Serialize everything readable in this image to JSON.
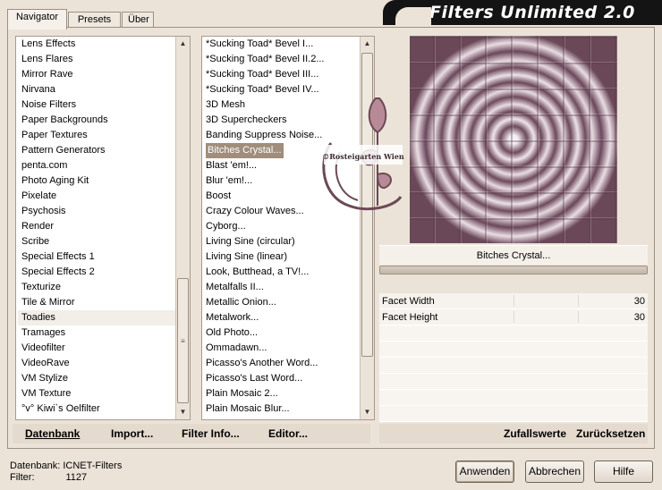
{
  "tabs": [
    "Navigator",
    "Presets",
    "Über"
  ],
  "banner_title": "Filters Unlimited 2.0",
  "categories": [
    "Lens Effects",
    "Lens Flares",
    "Mirror Rave",
    "Nirvana",
    "Noise Filters",
    "Paper Backgrounds",
    "Paper Textures",
    "Pattern Generators",
    "penta.com",
    "Photo Aging Kit",
    "Pixelate",
    "Psychosis",
    "Render",
    "Scribe",
    "Special Effects 1",
    "Special Effects 2",
    "Texturize",
    "Tile & Mirror",
    "Toadies",
    "Tramages",
    "Videofilter",
    "VideoRave",
    "VM Stylize",
    "VM Texture",
    "°v° Kiwi`s Oelfilter"
  ],
  "selected_category": "Toadies",
  "filters": [
    "*Sucking Toad*  Bevel I...",
    "*Sucking Toad*  Bevel II.2...",
    "*Sucking Toad*  Bevel III...",
    "*Sucking Toad*  Bevel IV...",
    "3D Mesh",
    "3D Supercheckers",
    "Banding Suppress Noise...",
    "Bitches Crystal...",
    "Blast 'em!...",
    "Blur 'em!...",
    "Boost",
    "Crazy Colour Waves...",
    "Cyborg...",
    "Living Sine (circular)",
    "Living Sine (linear)",
    "Look, Butthead, a TV!...",
    "Metalfalls II...",
    "Metallic Onion...",
    "Metalwork...",
    "Old Photo...",
    "Ommadawn...",
    "Picasso's Another Word...",
    "Picasso's Last Word...",
    "Plain Mosaic 2...",
    "Plain Mosaic Blur..."
  ],
  "selected_filter": "Bitches Crystal...",
  "watermark": {
    "text": "©Rosteigarten Wien"
  },
  "preview_filter_name": "Bitches Crystal...",
  "params": [
    {
      "name": "Facet Width",
      "value": "30"
    },
    {
      "name": "Facet Height",
      "value": "30"
    }
  ],
  "toolbar": {
    "datenbank": "Datenbank",
    "import": "Import...",
    "filter_info": "Filter Info...",
    "editor": "Editor...",
    "zufallswerte": "Zufallswerte",
    "zuruecksetzen": "Zurücksetzen"
  },
  "footer": {
    "db_label": "Datenbank:",
    "db_value": "ICNET-Filters",
    "filter_label": "Filter:",
    "filter_value": "1127"
  },
  "buttons": {
    "apply": "Anwenden",
    "cancel": "Abbrechen",
    "help": "Hilfe"
  },
  "colors": {
    "selection": "#a08d7b",
    "banner_bg": "#141414",
    "window_bg": "#ece3d8"
  }
}
